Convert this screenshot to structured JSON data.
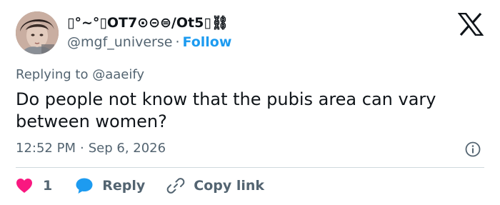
{
  "author": {
    "display_name": "▯°~°▯OT7⊙⊝⊜/Ot5▯⛓",
    "handle": "@mgf_universe",
    "separator": "·",
    "follow_label": "Follow"
  },
  "tweet": {
    "replying_prefix": "Replying to",
    "replying_to": "@aaeify",
    "text": "Do people not know that the pubis area can vary between women?",
    "time": "12:52 PM",
    "date_separator": "·",
    "date": "Sep 6, 2026"
  },
  "actions": {
    "like_count": "1",
    "reply_label": "Reply",
    "copy_link_label": "Copy link"
  },
  "colors": {
    "accent": "#1d9bf0",
    "like": "#f91880",
    "text_primary": "#0f1419",
    "text_secondary": "#536471",
    "divider": "#cfd9de"
  },
  "icons": {
    "logo": "x-logo-icon",
    "info": "info-icon",
    "like": "heart-icon",
    "reply": "reply-bubble-icon",
    "copy": "link-icon"
  }
}
